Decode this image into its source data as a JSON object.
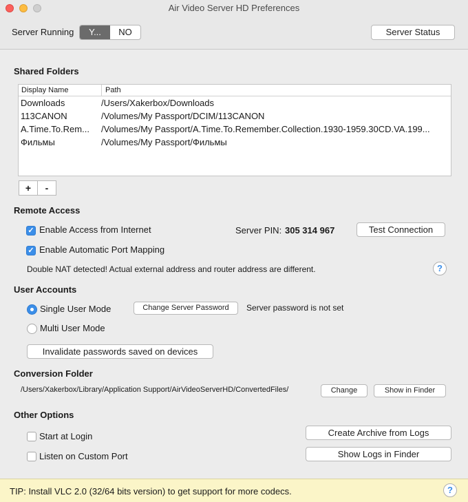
{
  "window": {
    "title": "Air Video Server HD Preferences"
  },
  "toolbar": {
    "server_running_label": "Server Running",
    "yes_label": "Y...",
    "no_label": "NO",
    "server_status_label": "Server Status"
  },
  "shared_folders": {
    "title": "Shared Folders",
    "columns": [
      "Display Name",
      "Path"
    ],
    "rows": [
      {
        "name": "Downloads",
        "path": "/Users/Xakerbox/Downloads"
      },
      {
        "name": "113CANON",
        "path": "/Volumes/My Passport/DCIM/113CANON"
      },
      {
        "name": "A.Time.To.Rem...",
        "path": "/Volumes/My Passport/A.Time.To.Remember.Collection.1930-1959.30CD.VA.199..."
      },
      {
        "name": "Фильмы",
        "path": "/Volumes/My Passport/Фильмы"
      }
    ],
    "add_label": "+",
    "remove_label": "-"
  },
  "remote_access": {
    "title": "Remote Access",
    "enable_internet_label": "Enable Access from Internet",
    "enable_port_mapping_label": "Enable Automatic Port Mapping",
    "server_pin_label": "Server PIN:",
    "server_pin_value": "305 314 967",
    "test_connection_label": "Test Connection",
    "nat_message": "Double NAT detected! Actual external address and router address are different.",
    "help_label": "?"
  },
  "user_accounts": {
    "title": "User Accounts",
    "single_user_label": "Single User Mode",
    "multi_user_label": "Multi User Mode",
    "change_password_label": "Change Server Password",
    "password_status": "Server password is not set",
    "invalidate_label": "Invalidate passwords saved on devices"
  },
  "conversion_folder": {
    "title": "Conversion Folder",
    "path": "/Users/Xakerbox/Library/Application Support/AirVideoServerHD/ConvertedFiles/",
    "change_label": "Change",
    "show_in_finder_label": "Show in Finder"
  },
  "other_options": {
    "title": "Other Options",
    "start_at_login_label": "Start at Login",
    "custom_port_label": "Listen on Custom Port",
    "create_archive_label": "Create Archive from Logs",
    "show_logs_label": "Show Logs in Finder"
  },
  "tip": {
    "text": "TIP: Install VLC 2.0 (32/64 bits version) to get support for more codecs.",
    "help_label": "?"
  },
  "colors": {
    "accent": "#3b8ee8",
    "tip_background": "#fbf5c8"
  }
}
